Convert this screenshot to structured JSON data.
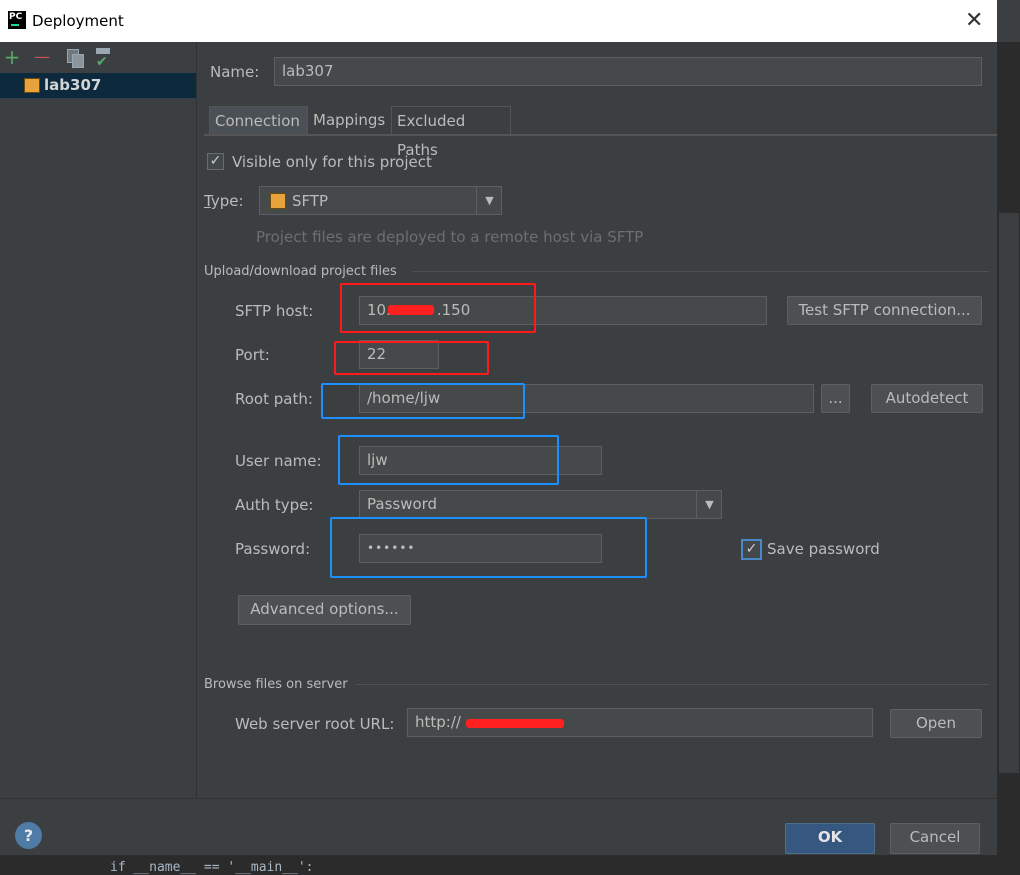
{
  "window": {
    "title": "Deployment",
    "app_icon_text": "PC"
  },
  "toolbar": {
    "add": "+",
    "remove": "—"
  },
  "sidebar": {
    "items": [
      {
        "label": "lab307",
        "icon": "sftp-server-icon"
      }
    ]
  },
  "name": {
    "label": "Name:",
    "value": "lab307"
  },
  "tabs": [
    {
      "label": "Connection"
    },
    {
      "label": "Mappings"
    },
    {
      "label": "Excluded Paths"
    }
  ],
  "visible_only": {
    "label": "Visible only for this project",
    "checked": true
  },
  "type": {
    "label": "Type:",
    "value": "SFTP",
    "hint": "Project files are deployed to a remote host via SFTP"
  },
  "upload_section": {
    "title": "Upload/download project files"
  },
  "sftp_host": {
    "label": "SFTP host:",
    "value_prefix": "10.",
    "value_suffix": ".150",
    "test_button": "Test SFTP connection..."
  },
  "port": {
    "label": "Port:",
    "value": "22"
  },
  "root_path": {
    "label": "Root path:",
    "value": "/home/ljw",
    "browse_button": "...",
    "autodetect_button": "Autodetect"
  },
  "user_name": {
    "label": "User name:",
    "value": "ljw"
  },
  "auth_type": {
    "label": "Auth type:",
    "value": "Password"
  },
  "password": {
    "label": "Password:",
    "value": "••••••",
    "save_label": "Save password",
    "save_checked": true
  },
  "advanced_button": "Advanced options...",
  "browse_section": {
    "title": "Browse files on server"
  },
  "web_root": {
    "label": "Web server root URL:",
    "value": "http://",
    "open_button": "Open"
  },
  "footer": {
    "help": "?",
    "ok": "OK",
    "cancel": "Cancel"
  },
  "background_code": "if __name__ == '__main__':",
  "colors": {
    "accent_blue": "#365880",
    "highlight_red": "#ff1a1a",
    "highlight_blue": "#1e8fff"
  }
}
